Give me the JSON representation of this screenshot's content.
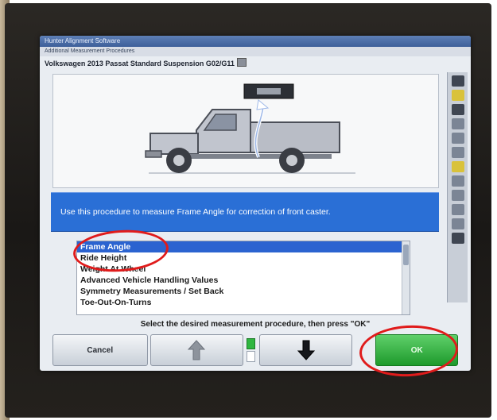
{
  "window": {
    "outer_title": "Hunter Alignment Software",
    "inner_title": "Additional Measurement Procedures"
  },
  "vehicle": {
    "title": "Volkswagen 2013 Passat Standard Suspension G02/G11"
  },
  "instruction": {
    "text": "Use this procedure to measure Frame Angle for correction of front caster."
  },
  "procedures": {
    "items": [
      {
        "label": "Frame Angle",
        "selected": true
      },
      {
        "label": "Ride Height",
        "selected": false
      },
      {
        "label": "Weight At Wheel",
        "selected": false
      },
      {
        "label": "Advanced Vehicle Handling Values",
        "selected": false
      },
      {
        "label": "Symmetry Measurements / Set Back",
        "selected": false
      },
      {
        "label": "Toe-Out-On-Turns",
        "selected": false
      }
    ]
  },
  "prompt": {
    "text": "Select the desired measurement procedure, then press \"OK\""
  },
  "buttons": {
    "cancel": "Cancel",
    "up_icon": "arrow-up-icon",
    "down_icon": "arrow-down-icon",
    "ok": "OK"
  },
  "colors": {
    "instruction_bar": "#2a6fd6",
    "selection": "#2b63d0",
    "ok_button": "#1e9a2c",
    "annotation_circle": "#e01b1b"
  }
}
